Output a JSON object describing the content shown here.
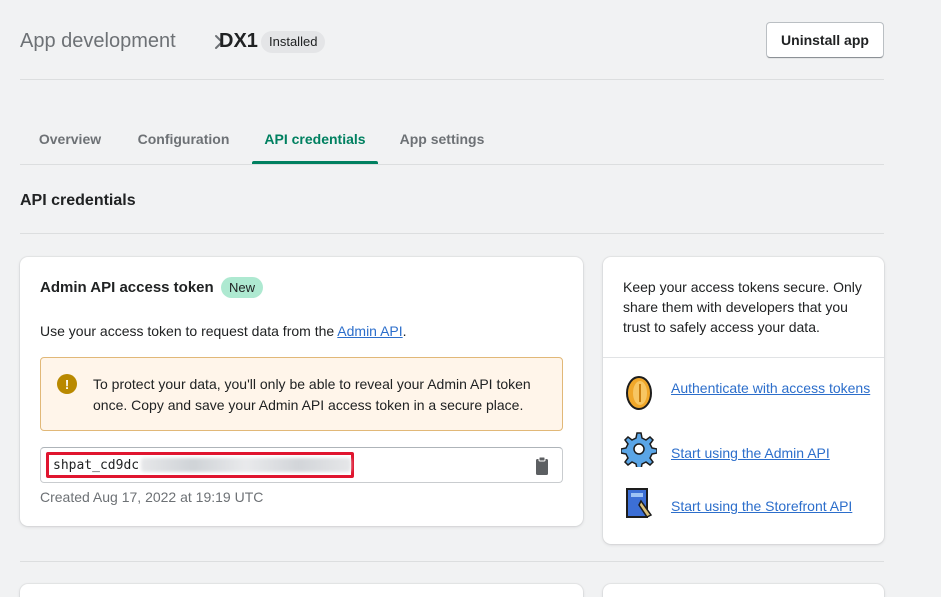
{
  "header": {
    "breadcrumb_parent": "App development",
    "app_name": "DX1",
    "status_badge": "Installed",
    "uninstall_label": "Uninstall app"
  },
  "tabs": [
    {
      "label": "Overview",
      "active": false
    },
    {
      "label": "Configuration",
      "active": false
    },
    {
      "label": "API credentials",
      "active": true
    },
    {
      "label": "App settings",
      "active": false
    }
  ],
  "section_title": "API credentials",
  "admin_card": {
    "title": "Admin API access token",
    "new_badge": "New",
    "description_prefix": "Use your access token to request data from the ",
    "description_link": "Admin API",
    "description_suffix": ".",
    "warning_text": "To protect your data, you'll only be able to reveal your Admin API token once. Copy and save your Admin API access token in a secure place.",
    "token_visible": "shpat_cd9dc",
    "created_text": "Created Aug 17, 2022 at 19:19 UTC"
  },
  "side_card": {
    "info_text": "Keep your access tokens secure. Only share them with developers that you trust to safely access your data.",
    "links": [
      {
        "label": "Authenticate with access tokens",
        "icon": "coin-icon"
      },
      {
        "label": "Start using the Admin API",
        "icon": "gear-icon"
      },
      {
        "label": "Start using the Storefront API",
        "icon": "storefront-icon"
      }
    ]
  },
  "colors": {
    "accent": "#008060",
    "link": "#2c6ecb",
    "highlight_border": "#e0152f",
    "warning_bg": "#fff5ea"
  }
}
